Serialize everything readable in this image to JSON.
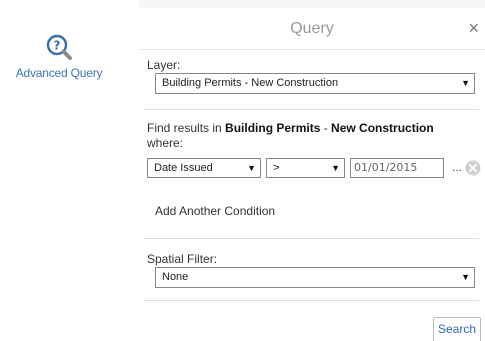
{
  "toolbox": {
    "advanced_query_label": "Advanced Query"
  },
  "panel": {
    "title": "Query",
    "close_glyph": "×"
  },
  "layer": {
    "label": "Layer:",
    "selected": "Building Permits - New Construction"
  },
  "find": {
    "prefix": "Find results in ",
    "layer_part1": "Building Permits",
    "separator": " - ",
    "layer_part2": "New Construction",
    "suffix": "where:"
  },
  "condition": {
    "field": "Date Issued",
    "operator": ">",
    "value": "01/01/2015",
    "ellipsis": "..."
  },
  "add_condition_label": "Add Another Condition",
  "spatial": {
    "label": "Spatial Filter:",
    "selected": "None"
  },
  "search_label": "Search",
  "arrow_glyph": "▼",
  "icons": {
    "toolbox": "magnifier-question-icon",
    "remove": "remove-condition-icon"
  },
  "colors": {
    "link": "#3a77b8",
    "title": "#999999",
    "button_text": "#2a6db4"
  }
}
